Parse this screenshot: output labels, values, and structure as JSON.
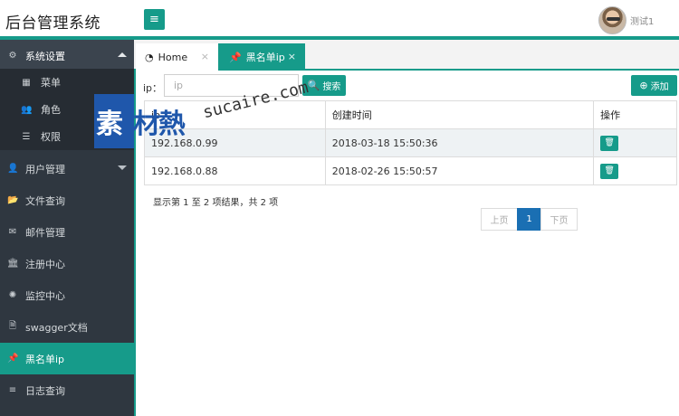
{
  "app": {
    "title": "后台管理系统"
  },
  "header": {
    "menu_icon": "hamburger-icon",
    "user": "测试1"
  },
  "sidebar": {
    "items": [
      {
        "label": "系统设置",
        "icon": "cogs-icon"
      },
      {
        "label": "用户管理",
        "icon": "user-icon"
      },
      {
        "label": "文件查询",
        "icon": "folder-icon"
      },
      {
        "label": "邮件管理",
        "icon": "envelope-icon"
      },
      {
        "label": "注册中心",
        "icon": "bank-icon"
      },
      {
        "label": "监控中心",
        "icon": "spinner-icon"
      },
      {
        "label": "swagger文档",
        "icon": "file-icon"
      },
      {
        "label": "黑名单ip",
        "icon": "pin-icon"
      },
      {
        "label": "日志查询",
        "icon": "list-icon"
      }
    ],
    "submenu": [
      {
        "label": "菜单",
        "icon": "windows-icon"
      },
      {
        "label": "角色",
        "icon": "users-icon"
      },
      {
        "label": "权限",
        "icon": "list-icon"
      }
    ]
  },
  "tabs": [
    {
      "label": "Home",
      "icon": "dashboard-icon",
      "close": "×"
    },
    {
      "label": "黑名单ip",
      "icon": "pin-icon",
      "close": "×"
    }
  ],
  "toolbar": {
    "ip_label": "ip：",
    "ip_placeholder": "ip",
    "search_label": "搜索",
    "add_label": "添加"
  },
  "table": {
    "columns": [
      "ip",
      "创建时间",
      "操作"
    ],
    "rows": [
      {
        "ip": "192.168.0.99",
        "created": "2018-03-18 15:50:36"
      },
      {
        "ip": "192.168.0.88",
        "created": "2018-02-26 15:50:57"
      }
    ]
  },
  "pagination": {
    "summary": "显示第 1 至 2 项结果，共 2 项",
    "prev": "上页",
    "current": "1",
    "next": "下页"
  },
  "watermark": {
    "text_a": "素",
    "text_b": "材熱",
    "site": "sucaire.com"
  }
}
